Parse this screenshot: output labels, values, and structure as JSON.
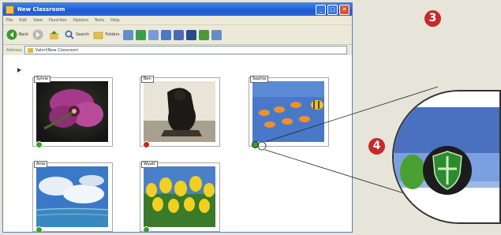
{
  "window": {
    "title": "New Classroom",
    "menu": [
      "File",
      "Edit",
      "View",
      "Favorites",
      "Options",
      "Tools",
      "Help"
    ],
    "toolbar": {
      "back_label": "Back",
      "search_label": "Search",
      "folders_label": "Folders"
    },
    "address": {
      "label": "Address",
      "value": "Valori\\New Classroom"
    }
  },
  "students": [
    {
      "name": "Sylvie",
      "image": "flower-photo",
      "status": "green"
    },
    {
      "name": "Ben",
      "image": "sculpture-photo",
      "status": "red"
    },
    {
      "name": "Sophia",
      "image": "fish-photo",
      "status": "green"
    },
    {
      "name": "Ania",
      "image": "sky-photo",
      "status": "green"
    },
    {
      "name": "Wyatt",
      "image": "tulips-photo",
      "status": "green"
    }
  ],
  "callouts": {
    "step_three": "3",
    "step_four": "4"
  },
  "colors": {
    "badge": "#c62a2a",
    "status_green": "#3aa02a",
    "status_red": "#cc2222",
    "shield": "#2e8a2e"
  },
  "zoom_icon": "shield-icon"
}
